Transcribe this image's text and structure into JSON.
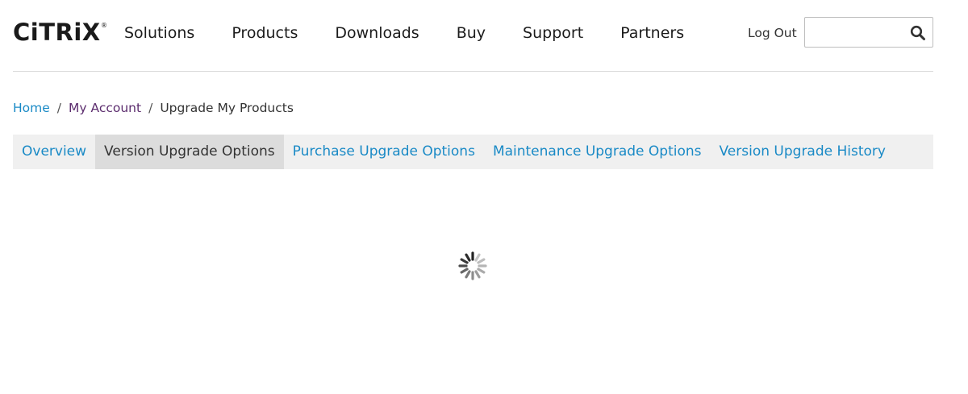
{
  "header": {
    "logo_text": "CiTRiX",
    "logo_reg": "®",
    "nav": [
      {
        "label": "Solutions"
      },
      {
        "label": "Products"
      },
      {
        "label": "Downloads"
      },
      {
        "label": "Buy"
      },
      {
        "label": "Support"
      },
      {
        "label": "Partners"
      }
    ],
    "logout_label": "Log Out",
    "search": {
      "placeholder": "",
      "value": ""
    }
  },
  "breadcrumb": {
    "home": "Home",
    "separator": "/",
    "account": "My Account",
    "current": "Upgrade My Products"
  },
  "tabs": [
    {
      "label": "Overview",
      "active": false
    },
    {
      "label": "Version Upgrade Options",
      "active": true
    },
    {
      "label": "Purchase Upgrade Options",
      "active": false
    },
    {
      "label": "Maintenance Upgrade Options",
      "active": false
    },
    {
      "label": "Version Upgrade History",
      "active": false
    }
  ],
  "icons": {
    "search": "search-icon",
    "spinner": "loading-spinner-icon"
  },
  "colors": {
    "link": "#1a8ac6",
    "visited_link": "#5c2d6e",
    "tab_bar": "#f0f0f0",
    "active_tab": "#dcdcdc"
  }
}
